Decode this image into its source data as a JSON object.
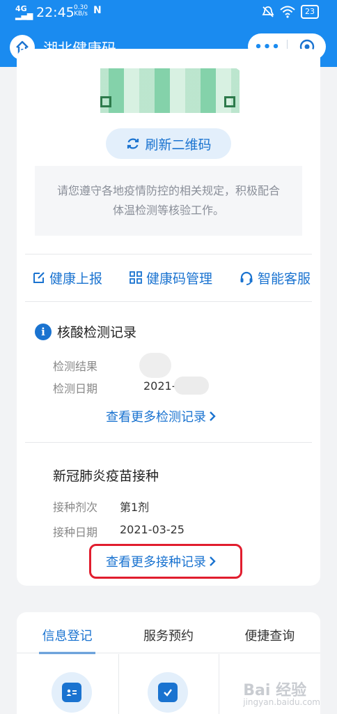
{
  "status_bar": {
    "signal": "4G",
    "time": "22:45",
    "speed_value": "0.30",
    "speed_unit": "KB/s",
    "battery": "23"
  },
  "nav": {
    "title": "湖北健康码",
    "more": "•••"
  },
  "qr": {
    "refresh_label": "刷新二维码",
    "notice": "请您遵守各地疫情防控的相关规定，积极配合体温检测等核验工作。"
  },
  "actions": [
    {
      "label": "健康上报",
      "icon": "edit-icon"
    },
    {
      "label": "健康码管理",
      "icon": "grid-icon"
    },
    {
      "label": "智能客服",
      "icon": "headset-icon"
    }
  ],
  "nucleic": {
    "title": "核酸检测记录",
    "result_label": "检测结果",
    "date_label": "检测日期",
    "date_value": "2021-",
    "more_link": "查看更多检测记录"
  },
  "vaccine": {
    "title": "新冠肺炎疫苗接种",
    "dose_label": "接种剂次",
    "dose_value": "第1剂",
    "date_label": "接种日期",
    "date_value": "2021-03-25",
    "more_link": "查看更多接种记录"
  },
  "tabs": [
    {
      "label": "信息登记",
      "active": true
    },
    {
      "label": "服务预约",
      "active": false
    },
    {
      "label": "便捷查询",
      "active": false
    }
  ],
  "watermark": {
    "brand": "Bai 经验",
    "sub": "jingyan.baidu.com"
  },
  "colors": {
    "brand_blue": "#1a8bf0",
    "link_blue": "#1a73d0",
    "highlight_red": "#e11d2e"
  }
}
